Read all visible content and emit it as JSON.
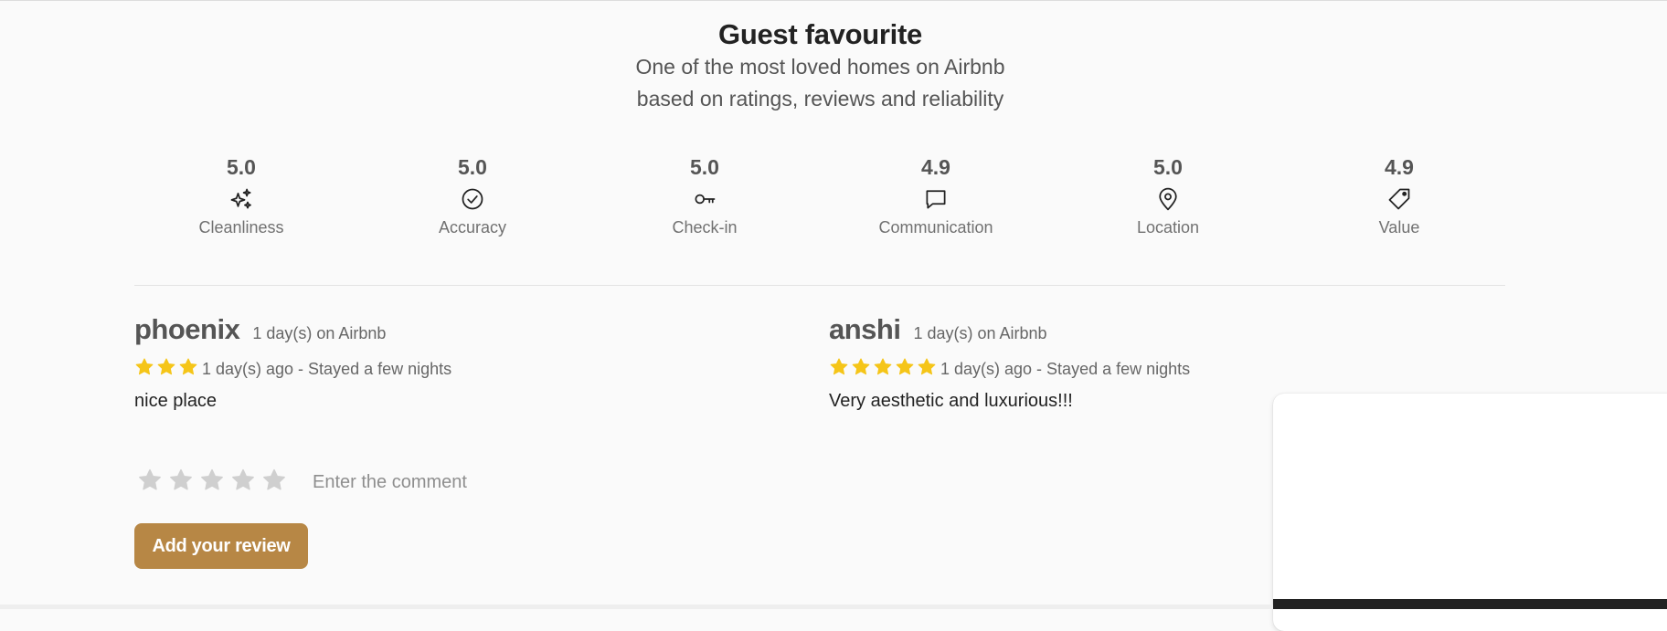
{
  "header": {
    "title": "Guest favourite",
    "subtitle_line1": "One of the most loved homes on Airbnb",
    "subtitle_line2": "based on ratings, reviews and reliability"
  },
  "ratings": [
    {
      "value": "5.0",
      "label": "Cleanliness",
      "icon": "sparkles-icon"
    },
    {
      "value": "5.0",
      "label": "Accuracy",
      "icon": "check-circle-icon"
    },
    {
      "value": "5.0",
      "label": "Check-in",
      "icon": "key-icon"
    },
    {
      "value": "4.9",
      "label": "Communication",
      "icon": "chat-bubble-icon"
    },
    {
      "value": "5.0",
      "label": "Location",
      "icon": "map-pin-icon"
    },
    {
      "value": "4.9",
      "label": "Value",
      "icon": "price-tag-icon"
    }
  ],
  "reviews": [
    {
      "name": "phoenix",
      "tenure": "1 day(s) on Airbnb",
      "stars": 3,
      "when": "1 day(s) ago - Stayed a few nights",
      "comment": "nice place"
    },
    {
      "name": "anshi",
      "tenure": "1 day(s) on Airbnb",
      "stars": 5,
      "when": "1 day(s) ago - Stayed a few nights",
      "comment": "Very aesthetic and luxurious!!!"
    }
  ],
  "compose": {
    "star_count": 5,
    "selected_stars": 0,
    "placeholder": "Enter the comment"
  },
  "add_review_label": "Add your review",
  "colors": {
    "star_filled": "#f5c518",
    "star_empty": "#cfcfcf",
    "button_bg": "#b78745",
    "text_main": "#222222",
    "text_muted": "#717171"
  }
}
